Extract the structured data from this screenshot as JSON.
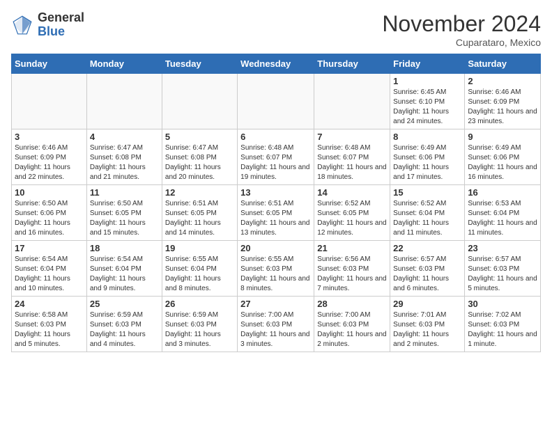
{
  "logo": {
    "general": "General",
    "blue": "Blue"
  },
  "title": "November 2024",
  "location": "Cuparataro, Mexico",
  "weekdays": [
    "Sunday",
    "Monday",
    "Tuesday",
    "Wednesday",
    "Thursday",
    "Friday",
    "Saturday"
  ],
  "weeks": [
    [
      {
        "day": "",
        "info": ""
      },
      {
        "day": "",
        "info": ""
      },
      {
        "day": "",
        "info": ""
      },
      {
        "day": "",
        "info": ""
      },
      {
        "day": "",
        "info": ""
      },
      {
        "day": "1",
        "info": "Sunrise: 6:45 AM\nSunset: 6:10 PM\nDaylight: 11 hours and 24 minutes."
      },
      {
        "day": "2",
        "info": "Sunrise: 6:46 AM\nSunset: 6:09 PM\nDaylight: 11 hours and 23 minutes."
      }
    ],
    [
      {
        "day": "3",
        "info": "Sunrise: 6:46 AM\nSunset: 6:09 PM\nDaylight: 11 hours and 22 minutes."
      },
      {
        "day": "4",
        "info": "Sunrise: 6:47 AM\nSunset: 6:08 PM\nDaylight: 11 hours and 21 minutes."
      },
      {
        "day": "5",
        "info": "Sunrise: 6:47 AM\nSunset: 6:08 PM\nDaylight: 11 hours and 20 minutes."
      },
      {
        "day": "6",
        "info": "Sunrise: 6:48 AM\nSunset: 6:07 PM\nDaylight: 11 hours and 19 minutes."
      },
      {
        "day": "7",
        "info": "Sunrise: 6:48 AM\nSunset: 6:07 PM\nDaylight: 11 hours and 18 minutes."
      },
      {
        "day": "8",
        "info": "Sunrise: 6:49 AM\nSunset: 6:06 PM\nDaylight: 11 hours and 17 minutes."
      },
      {
        "day": "9",
        "info": "Sunrise: 6:49 AM\nSunset: 6:06 PM\nDaylight: 11 hours and 16 minutes."
      }
    ],
    [
      {
        "day": "10",
        "info": "Sunrise: 6:50 AM\nSunset: 6:06 PM\nDaylight: 11 hours and 16 minutes."
      },
      {
        "day": "11",
        "info": "Sunrise: 6:50 AM\nSunset: 6:05 PM\nDaylight: 11 hours and 15 minutes."
      },
      {
        "day": "12",
        "info": "Sunrise: 6:51 AM\nSunset: 6:05 PM\nDaylight: 11 hours and 14 minutes."
      },
      {
        "day": "13",
        "info": "Sunrise: 6:51 AM\nSunset: 6:05 PM\nDaylight: 11 hours and 13 minutes."
      },
      {
        "day": "14",
        "info": "Sunrise: 6:52 AM\nSunset: 6:05 PM\nDaylight: 11 hours and 12 minutes."
      },
      {
        "day": "15",
        "info": "Sunrise: 6:52 AM\nSunset: 6:04 PM\nDaylight: 11 hours and 11 minutes."
      },
      {
        "day": "16",
        "info": "Sunrise: 6:53 AM\nSunset: 6:04 PM\nDaylight: 11 hours and 11 minutes."
      }
    ],
    [
      {
        "day": "17",
        "info": "Sunrise: 6:54 AM\nSunset: 6:04 PM\nDaylight: 11 hours and 10 minutes."
      },
      {
        "day": "18",
        "info": "Sunrise: 6:54 AM\nSunset: 6:04 PM\nDaylight: 11 hours and 9 minutes."
      },
      {
        "day": "19",
        "info": "Sunrise: 6:55 AM\nSunset: 6:04 PM\nDaylight: 11 hours and 8 minutes."
      },
      {
        "day": "20",
        "info": "Sunrise: 6:55 AM\nSunset: 6:03 PM\nDaylight: 11 hours and 8 minutes."
      },
      {
        "day": "21",
        "info": "Sunrise: 6:56 AM\nSunset: 6:03 PM\nDaylight: 11 hours and 7 minutes."
      },
      {
        "day": "22",
        "info": "Sunrise: 6:57 AM\nSunset: 6:03 PM\nDaylight: 11 hours and 6 minutes."
      },
      {
        "day": "23",
        "info": "Sunrise: 6:57 AM\nSunset: 6:03 PM\nDaylight: 11 hours and 5 minutes."
      }
    ],
    [
      {
        "day": "24",
        "info": "Sunrise: 6:58 AM\nSunset: 6:03 PM\nDaylight: 11 hours and 5 minutes."
      },
      {
        "day": "25",
        "info": "Sunrise: 6:59 AM\nSunset: 6:03 PM\nDaylight: 11 hours and 4 minutes."
      },
      {
        "day": "26",
        "info": "Sunrise: 6:59 AM\nSunset: 6:03 PM\nDaylight: 11 hours and 3 minutes."
      },
      {
        "day": "27",
        "info": "Sunrise: 7:00 AM\nSunset: 6:03 PM\nDaylight: 11 hours and 3 minutes."
      },
      {
        "day": "28",
        "info": "Sunrise: 7:00 AM\nSunset: 6:03 PM\nDaylight: 11 hours and 2 minutes."
      },
      {
        "day": "29",
        "info": "Sunrise: 7:01 AM\nSunset: 6:03 PM\nDaylight: 11 hours and 2 minutes."
      },
      {
        "day": "30",
        "info": "Sunrise: 7:02 AM\nSunset: 6:03 PM\nDaylight: 11 hours and 1 minute."
      }
    ]
  ]
}
